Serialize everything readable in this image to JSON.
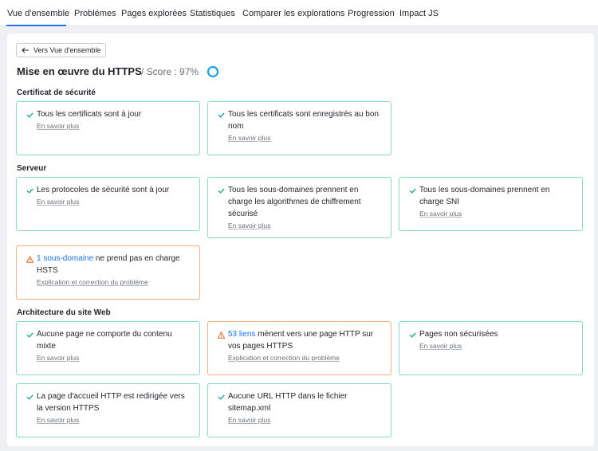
{
  "tabs": [
    {
      "label": "Vue d'ensemble",
      "active": true
    },
    {
      "label": "Problèmes"
    },
    {
      "label": "Pages explorées"
    },
    {
      "label": "Statistiques"
    },
    {
      "label": "Comparer les explorations"
    },
    {
      "label": "Progression"
    },
    {
      "label": "Impact JS"
    }
  ],
  "colors": {
    "accent": "#1a73e8",
    "ok_border": "#7fdccf",
    "ok_check": "#0f9d8a",
    "warn_border": "#f3b27e",
    "warn_icon": "#e8672a"
  },
  "back_button": {
    "label": "Vers Vue d'ensemble"
  },
  "header": {
    "title": "Mise en œuvre du HTTPS",
    "score": "/ Score : 97%",
    "score_value": 0.97
  },
  "sections": [
    {
      "title": "Certificat de sécurité",
      "cards": [
        {
          "status": "ok",
          "text": "Tous les certificats sont à jour",
          "more": "En savoir plus"
        },
        {
          "status": "ok",
          "text": "Tous les certificats sont enregistrés au bon nom",
          "more": "En savoir plus"
        }
      ]
    },
    {
      "title": "Serveur",
      "cards": [
        {
          "status": "ok",
          "text": "Les protocoles de sécurité sont à jour",
          "more": "En savoir plus"
        },
        {
          "status": "ok",
          "text": "Tous les sous-domaines prennent en charge les algorithmes de chiffrement sécurisé",
          "more": "En savoir plus"
        },
        {
          "status": "ok",
          "text": "Tous les sous-domaines prennent en charge SNI",
          "more": "En savoir plus"
        },
        {
          "status": "warn",
          "link": "1 sous-domaine",
          "text": " ne prend pas en charge HSTS",
          "more": "Explication et correction du problème"
        }
      ]
    },
    {
      "title": "Architecture du site Web",
      "cards": [
        {
          "status": "ok",
          "text": "Aucune page ne comporte du contenu mixte",
          "more": "En savoir plus"
        },
        {
          "status": "warn",
          "link": "53 liens",
          "text": " mènent vers une page HTTP sur vos pages HTTPS",
          "more": "Explication et correction du problème"
        },
        {
          "status": "ok",
          "text": "Pages non sécurisées",
          "more": "En savoir plus"
        },
        {
          "status": "ok",
          "text": "La page d'accueil HTTP est redirigée vers la version HTTPS",
          "more": "En savoir plus"
        },
        {
          "status": "ok",
          "text": "Aucune URL HTTP dans le fichier sitemap.xml",
          "more": "En savoir plus"
        }
      ]
    }
  ]
}
